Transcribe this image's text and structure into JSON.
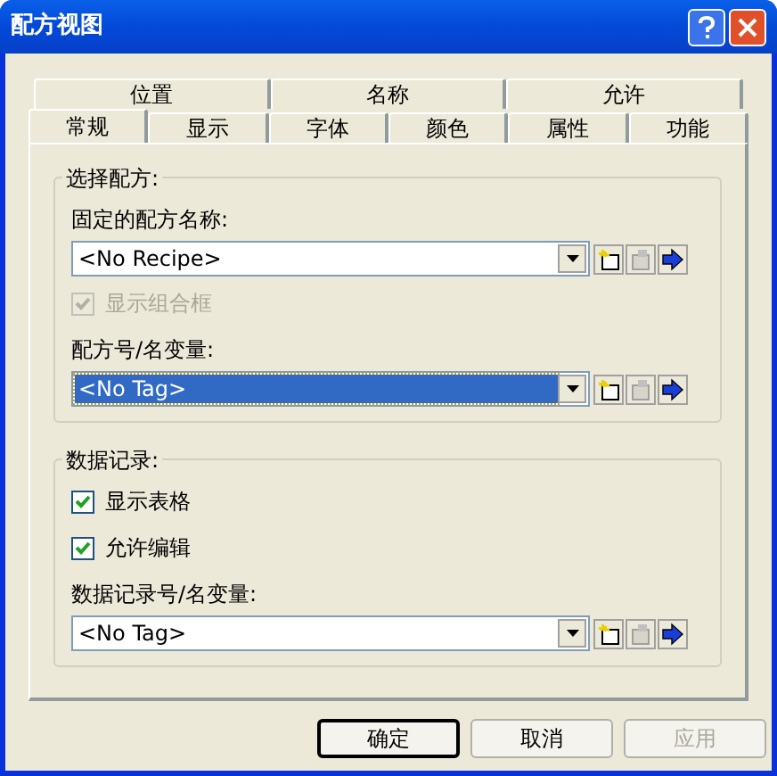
{
  "window": {
    "title": "配方视图"
  },
  "tab_rows": [
    {
      "tabs": [
        {
          "label": "位置",
          "selected": false
        },
        {
          "label": "名称",
          "selected": false
        },
        {
          "label": "允许",
          "selected": false
        }
      ]
    },
    {
      "tabs": [
        {
          "label": "常规",
          "selected": true
        },
        {
          "label": "显示",
          "selected": false
        },
        {
          "label": "字体",
          "selected": false
        },
        {
          "label": "颜色",
          "selected": false
        },
        {
          "label": "属性",
          "selected": false
        },
        {
          "label": "功能",
          "selected": false
        }
      ]
    }
  ],
  "groups": [
    {
      "title": "选择配方:",
      "items": [
        {
          "kind": "label",
          "text": "固定的配方名称:"
        },
        {
          "kind": "combo",
          "value": "<No Recipe>",
          "focused": false
        },
        {
          "kind": "checkbox",
          "label": "显示组合框",
          "checked": true,
          "disabled": true
        },
        {
          "kind": "label",
          "text": "配方号/名变量:"
        },
        {
          "kind": "combo",
          "value": "<No Tag>",
          "focused": true
        }
      ]
    },
    {
      "title": "数据记录:",
      "items": [
        {
          "kind": "checkbox",
          "label": "显示表格",
          "checked": true,
          "disabled": false
        },
        {
          "kind": "checkbox",
          "label": "允许编辑",
          "checked": true,
          "disabled": false
        },
        {
          "kind": "label",
          "text": "数据记录号/名变量:"
        },
        {
          "kind": "combo",
          "value": "<No Tag>",
          "focused": false
        }
      ]
    }
  ],
  "buttons": [
    {
      "label": "确定",
      "default": true,
      "disabled": false
    },
    {
      "label": "取消",
      "default": false,
      "disabled": false
    },
    {
      "label": "应用",
      "default": false,
      "disabled": true
    }
  ]
}
